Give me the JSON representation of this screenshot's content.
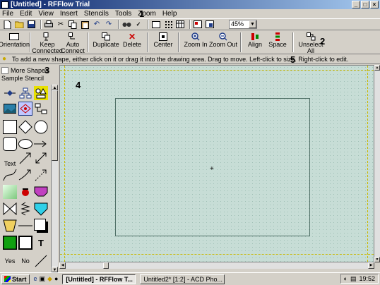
{
  "window": {
    "title": "[Untitled] - RFFlow Trial"
  },
  "menu": [
    "File",
    "Edit",
    "View",
    "Insert",
    "Stencils",
    "Tools",
    "Zoom",
    "Help"
  ],
  "callouts": {
    "menu": "1",
    "toolbar": "2",
    "shapes": "3",
    "canvas": "4",
    "hint": "5"
  },
  "toolbar1": {
    "zoom_value": "45%"
  },
  "toolbar2": {
    "buttons": [
      {
        "label": "Orientation",
        "icon": "page-icon"
      },
      {
        "label": "Keep\nConnected",
        "icon": "keep-connected-icon"
      },
      {
        "label": "Auto\nConnect",
        "icon": "auto-connect-icon"
      },
      {
        "label": "Duplicate",
        "icon": "duplicate-icon"
      },
      {
        "label": "Delete",
        "icon": "delete-icon"
      },
      {
        "label": "Center",
        "icon": "center-icon"
      },
      {
        "label": "Zoom In",
        "icon": "zoom-in-icon"
      },
      {
        "label": "Zoom Out",
        "icon": "zoom-out-icon"
      },
      {
        "label": "Align",
        "icon": "align-icon"
      },
      {
        "label": "Space",
        "icon": "space-icon"
      },
      {
        "label": "Unselect\nAll",
        "icon": "unselect-icon"
      }
    ]
  },
  "hint": "To add a new shape, either click on it or drag it into the drawing area. Drag to move. Left-click to size. Right-click to edit.",
  "left_panel": {
    "more_shapes": "More Shapes",
    "stencil": "Sample Stencil",
    "text_label": "Text",
    "yes_label": "Yes",
    "no_label": "No",
    "t_label": "T"
  },
  "taskbar": {
    "start": "Start",
    "tasks": [
      "[Untitled] - RFFlow T...",
      "Untitled2* [1:2] - ACD Pho..."
    ],
    "time": "19:52"
  }
}
